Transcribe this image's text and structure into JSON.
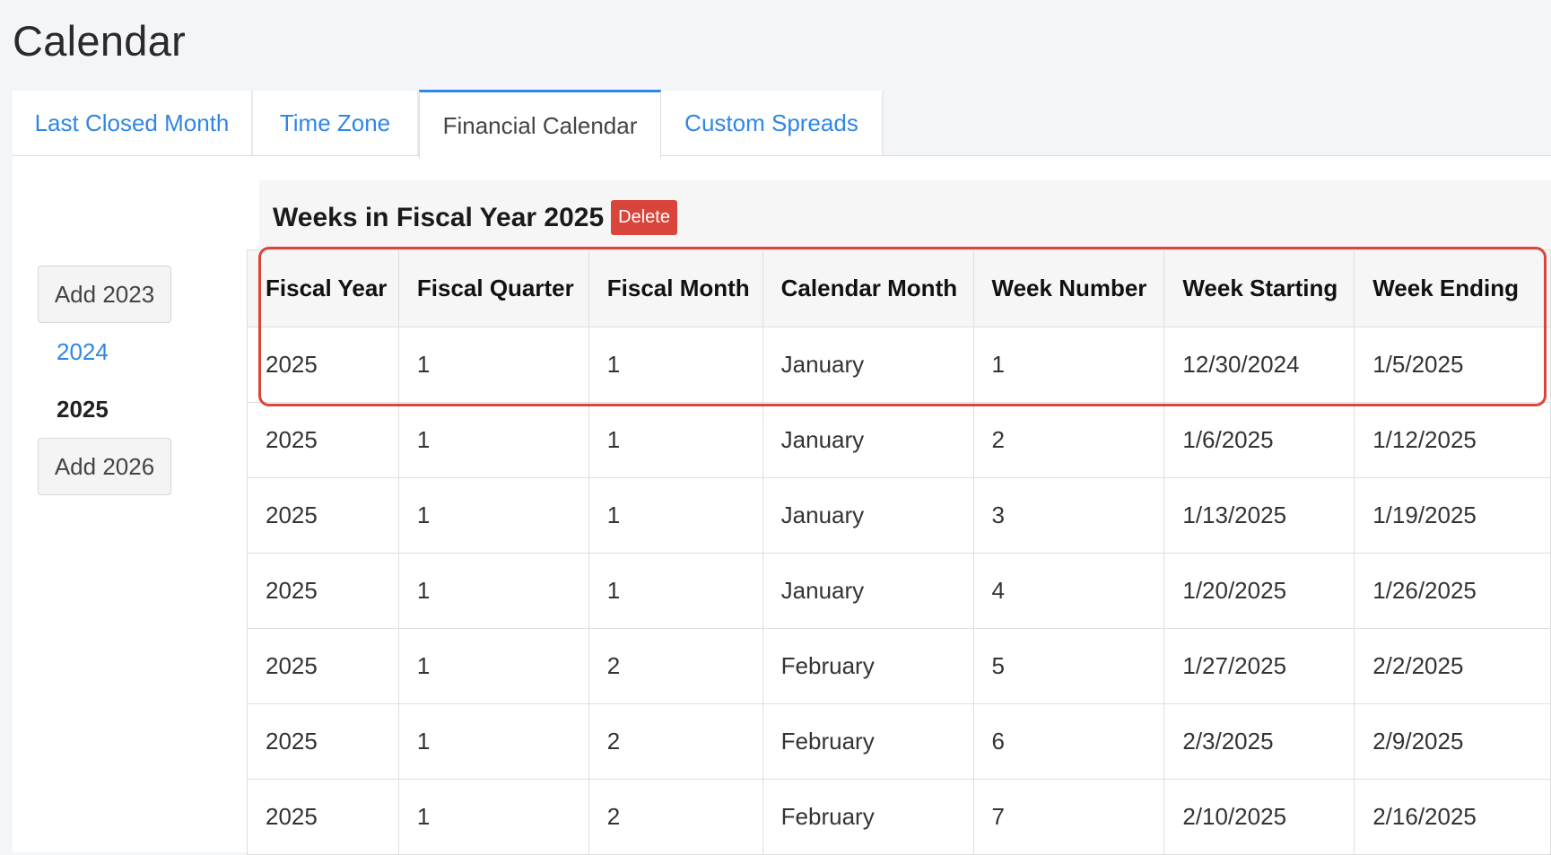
{
  "page": {
    "title": "Calendar"
  },
  "tabs": [
    {
      "label": "Last Closed Month"
    },
    {
      "label": "Time Zone"
    },
    {
      "label": "Financial Calendar"
    },
    {
      "label": "Custom Spreads"
    }
  ],
  "years": {
    "add_2023": "Add 2023",
    "link_2024": "2024",
    "current_2025": "2025",
    "add_2026": "Add 2026"
  },
  "weeks": {
    "title": "Weeks in Fiscal Year 2025",
    "delete_label": "Delete"
  },
  "table": {
    "headers": [
      "Fiscal Year",
      "Fiscal Quarter",
      "Fiscal Month",
      "Calendar Month",
      "Week Number",
      "Week Starting",
      "Week Ending"
    ],
    "rows": [
      [
        "2025",
        "1",
        "1",
        "January",
        "1",
        "12/30/2024",
        "1/5/2025"
      ],
      [
        "2025",
        "1",
        "1",
        "January",
        "2",
        "1/6/2025",
        "1/12/2025"
      ],
      [
        "2025",
        "1",
        "1",
        "January",
        "3",
        "1/13/2025",
        "1/19/2025"
      ],
      [
        "2025",
        "1",
        "1",
        "January",
        "4",
        "1/20/2025",
        "1/26/2025"
      ],
      [
        "2025",
        "1",
        "2",
        "February",
        "5",
        "1/27/2025",
        "2/2/2025"
      ],
      [
        "2025",
        "1",
        "2",
        "February",
        "6",
        "2/3/2025",
        "2/9/2025"
      ],
      [
        "2025",
        "1",
        "2",
        "February",
        "7",
        "2/10/2025",
        "2/16/2025"
      ]
    ]
  },
  "colors": {
    "accent": "#2f86e6",
    "danger": "#d9453b"
  }
}
